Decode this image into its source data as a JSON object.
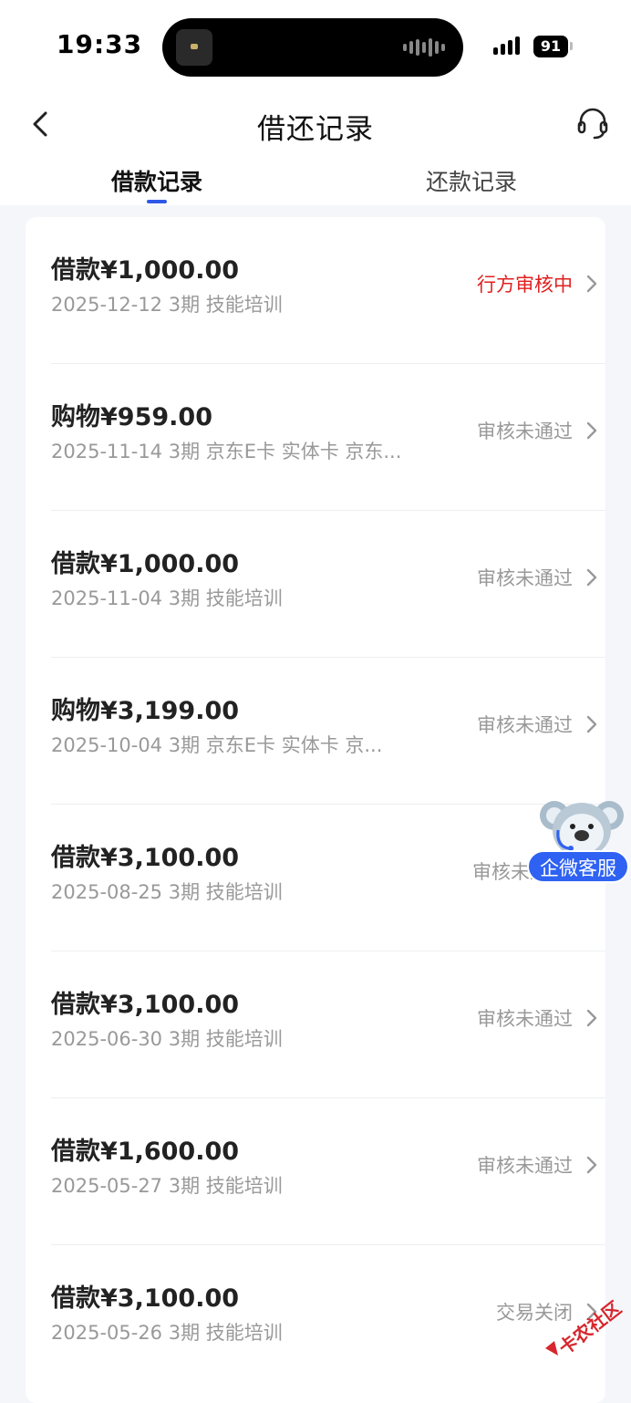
{
  "status_bar": {
    "time": "19:33",
    "battery": "91"
  },
  "header": {
    "title": "借还记录",
    "tabs": [
      {
        "label": "借款记录",
        "active": true
      },
      {
        "label": "还款记录",
        "active": false
      }
    ]
  },
  "records": [
    {
      "title": "借款¥1,000.00",
      "subtitle": "2025-12-12 3期  技能培训",
      "status": "行方审核中",
      "status_color": "#e02020"
    },
    {
      "title": "购物¥959.00",
      "subtitle": "2025-11-14 3期  京东E卡 实体卡 京东...",
      "status": "审核未通过",
      "status_color": "#999999"
    },
    {
      "title": "借款¥1,000.00",
      "subtitle": "2025-11-04 3期  技能培训",
      "status": "审核未通过",
      "status_color": "#999999"
    },
    {
      "title": "购物¥3,199.00",
      "subtitle": "2025-10-04 3期  京东E卡 实体卡 京...",
      "status": "审核未通过",
      "status_color": "#999999"
    },
    {
      "title": "借款¥3,100.00",
      "subtitle": "2025-08-25 3期  技能培训",
      "status": "审核未通",
      "status_color": "#999999"
    },
    {
      "title": "借款¥3,100.00",
      "subtitle": "2025-06-30 3期  技能培训",
      "status": "审核未通过",
      "status_color": "#999999"
    },
    {
      "title": "借款¥1,600.00",
      "subtitle": "2025-05-27 3期  技能培训",
      "status": "审核未通过",
      "status_color": "#999999"
    },
    {
      "title": "借款¥3,100.00",
      "subtitle": "2025-05-26 3期  技能培训",
      "status": "交易关闭",
      "status_color": "#999999"
    }
  ],
  "float_service": {
    "label": "企微客服"
  },
  "watermark": {
    "text": "卡农社区"
  },
  "colors": {
    "accent": "#2f58e8",
    "pending_red": "#e02020",
    "muted": "#999999"
  },
  "icons": {
    "back": "chevron-left-icon",
    "support": "headset-icon",
    "row": "chevron-right-icon"
  }
}
